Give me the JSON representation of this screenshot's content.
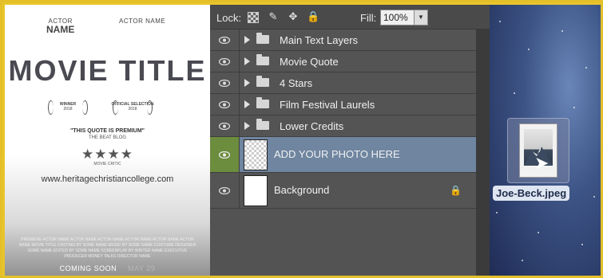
{
  "poster": {
    "actor1_small": "ACTOR",
    "actor1_big": "NAME",
    "actor2": "ACTOR NAME",
    "title": "MOVIE TITLE",
    "laurel1_text": "WINNER",
    "laurel1_year": "2018",
    "laurel2_text": "OFFICIAL SELECTION",
    "laurel2_year": "2018",
    "quote": "\"THIS QUOTE IS PREMIUM\"",
    "quote_source": "THE BEAT BLOG",
    "stars": "★★★★",
    "critic": "MOVIE CRITIC",
    "watermark": "www.heritagechristiancollege.com",
    "credits": "PREMIERE ACTOR NAME ACTOR NAME ACTOR NAME ACTOR NAME ACTOR NAME ACTOR NAME MOVIE TITLE CASTING BY SOME NAME MUSIC BY SOME NAME COSTUME DESIGNER SOME NAME EDITED BY SOME NAME SCREENPLAY BY WRITER NAME EXECUTIVE PRODUCER MONEY TALKS DIRECTOR NAME",
    "coming_soon": "COMING SOON",
    "date": "MAY 29"
  },
  "lock_bar": {
    "lock_label": "Lock:",
    "fill_label": "Fill:",
    "fill_value": "100%",
    "brush_glyph": "✎",
    "move_glyph": "✥",
    "lock_glyph": "🔒",
    "dropdown_glyph": "▼"
  },
  "layers": [
    {
      "name": "Main Text Layers"
    },
    {
      "name": "Movie Quote"
    },
    {
      "name": "4 Stars"
    },
    {
      "name": "Film Festival Laurels"
    },
    {
      "name": "Lower Credits"
    },
    {
      "name": "ADD YOUR PHOTO HERE"
    },
    {
      "name": "Background"
    }
  ],
  "background_lock_glyph": "🔒",
  "desktop": {
    "file_name": "Joe-Beck.jpeg",
    "cursor_glyph": "➤"
  },
  "colors": {
    "selected_layer": "#6f85a0",
    "visibility_active": "#6c8c3e",
    "panel": "#535353",
    "border": "#e3c02a"
  }
}
